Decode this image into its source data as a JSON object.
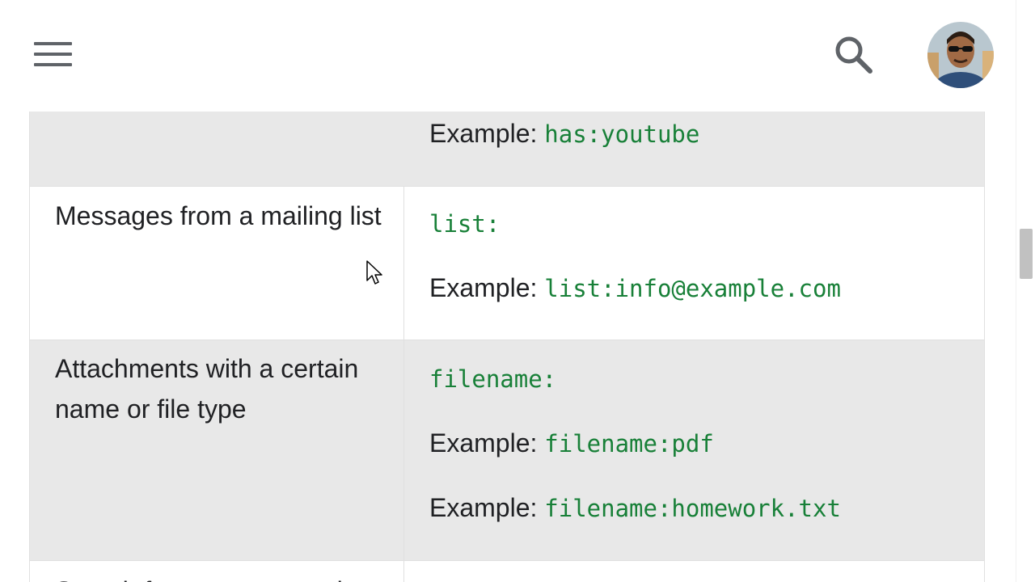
{
  "header": {
    "menu_icon": "hamburger-menu-icon",
    "search_icon": "search-icon",
    "avatar_icon": "user-avatar"
  },
  "table": {
    "rows": [
      {
        "description": "",
        "lines": [
          {
            "label": "Example: ",
            "code": "has:youtube"
          }
        ]
      },
      {
        "description": "Messages from a mailing list",
        "lines": [
          {
            "label": "",
            "code": "list:"
          },
          {
            "label": "Example: ",
            "code": "list:info@example.com"
          }
        ]
      },
      {
        "description": "Attachments with a certain name or file type",
        "lines": [
          {
            "label": "",
            "code": "filename:"
          },
          {
            "label": "Example: ",
            "code": "filename:pdf"
          },
          {
            "label": "Example: ",
            "code": "filename:homework.txt"
          }
        ]
      },
      {
        "description": "Search for an exact word",
        "lines": []
      }
    ]
  },
  "colors": {
    "code": "#188038",
    "shaded_row": "#e8e8e8",
    "icon": "#5f6368"
  }
}
